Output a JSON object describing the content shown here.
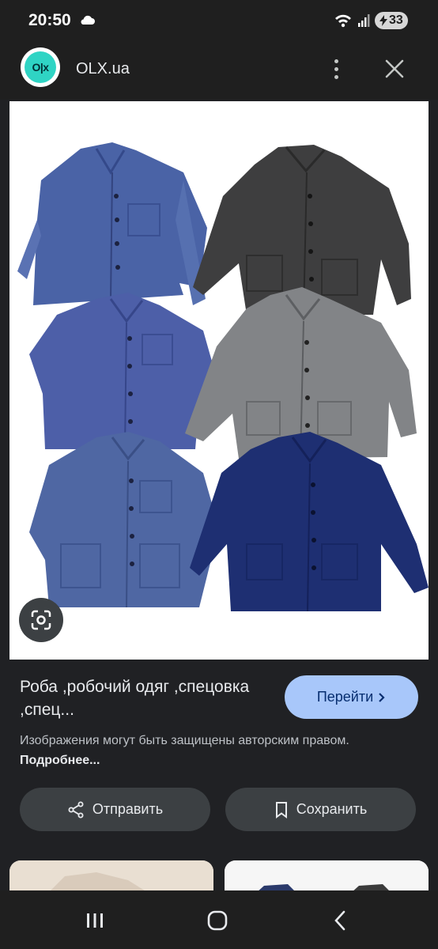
{
  "status_bar": {
    "time": "20:50",
    "battery": "33"
  },
  "header": {
    "site_name": "OLX.ua",
    "logo_text": "OLX"
  },
  "image": {
    "alt": "Six vintage French work jackets: three faded blue, one dark grey, one grey tweed, one navy"
  },
  "result": {
    "title": "Роба ,робочий одяг ,спецовка ,спец...",
    "go_label": "Перейти",
    "copyright_text": "Изображения могут быть защищены авторским правом.",
    "more_link": "Подробнее..."
  },
  "actions": {
    "share_label": "Отправить",
    "save_label": "Сохранить"
  },
  "colors": {
    "accent": "#a8c7fa",
    "background": "#202124",
    "button": "#3c4043"
  }
}
